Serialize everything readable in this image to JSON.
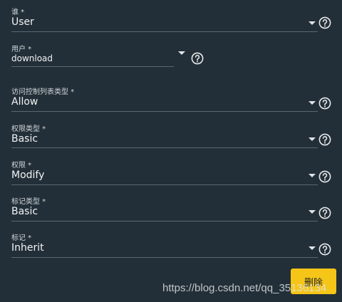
{
  "form": {
    "fields": [
      {
        "label": "谁 *",
        "value": "User"
      },
      {
        "label": "用户 *",
        "value": "download"
      },
      {
        "label": "访问控制列表类型 *",
        "value": "Allow"
      },
      {
        "label": "权限类型 *",
        "value": "Basic"
      },
      {
        "label": "权限 *",
        "value": "Modify"
      },
      {
        "label": "标记类型 *",
        "value": "Basic"
      },
      {
        "label": "标记 *",
        "value": "Inherit"
      }
    ]
  },
  "actions": {
    "delete_label": "删除"
  },
  "watermark": "https://blog.csdn.net/qq_35136134",
  "colors": {
    "background": "#232f38",
    "accent_button": "#f5c518"
  },
  "icons": {
    "help": "help-circle-icon",
    "dropdown": "caret-down-icon"
  }
}
